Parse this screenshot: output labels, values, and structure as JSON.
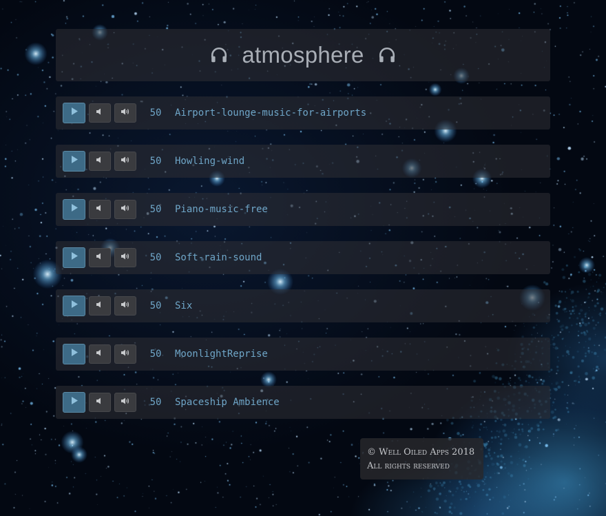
{
  "header": {
    "title": "atmosphere",
    "left_icon": "headphones-icon",
    "right_icon": "headphones-icon"
  },
  "controls": {
    "play_icon": "play-icon",
    "volume_down_icon": "volume-down-icon",
    "volume_up_icon": "volume-up-icon"
  },
  "tracks": [
    {
      "volume": "50",
      "name": "Airport-lounge-music-for-airports"
    },
    {
      "volume": "50",
      "name": "Howling-wind"
    },
    {
      "volume": "50",
      "name": "Piano-music-free"
    },
    {
      "volume": "50",
      "name": "Soft-rain-sound"
    },
    {
      "volume": "50",
      "name": "Six"
    },
    {
      "volume": "50",
      "name": "MoonlightReprise"
    },
    {
      "volume": "50",
      "name": "Spaceship Ambience"
    }
  ],
  "footer": {
    "line1": "© Well Oiled Apps 2018",
    "line2": "All rights reserved"
  },
  "colors": {
    "accent": "#6fa6c8",
    "play_button": "#3d6a86",
    "panel": "#303034",
    "background": "#040a16"
  }
}
